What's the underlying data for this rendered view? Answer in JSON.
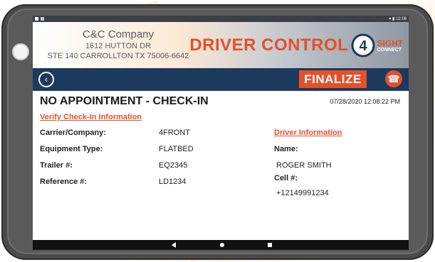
{
  "company": {
    "name": "C&C Company",
    "address_line1": "1612 HUTTON DR",
    "address_line2": "STE 140 CARROLLTON TX 75006-6642"
  },
  "brand": {
    "title": "DRIVER CONTROL",
    "sub_title": "SIGHT",
    "sub_small": "CONNECT"
  },
  "statusbar": {
    "time": "12:08"
  },
  "toolbar": {
    "finalize_label": "FINALIZE"
  },
  "page": {
    "title": "NO APPOINTMENT - CHECK-IN",
    "timestamp": "07/28/2020 12:08:22 PM"
  },
  "checkin": {
    "section_title": "Verify Check-In Information",
    "fields": [
      {
        "label": "Carrier/Company:",
        "value": "4FRONT"
      },
      {
        "label": "Equipment Type:",
        "value": "FLATBED"
      },
      {
        "label": "Trailer #:",
        "value": "EQ2345"
      },
      {
        "label": "Reference #:",
        "value": "LD1234"
      }
    ]
  },
  "driver": {
    "section_title": "Driver Information",
    "name_label": "Name:",
    "name_value": "ROGER SMITH",
    "cell_label": "Cell #:",
    "cell_value": "+12149991234"
  },
  "colors": {
    "accent": "#e4502a",
    "navbar": "#1c3a5c"
  }
}
